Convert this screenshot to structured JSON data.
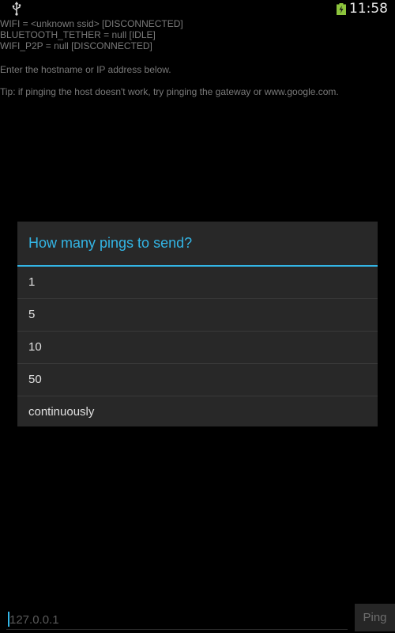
{
  "status_bar": {
    "usb_icon": "usb-icon",
    "battery_icon": "battery-charging-icon",
    "time": "11:58"
  },
  "network_status": [
    "WIFI = <unknown ssid> [DISCONNECTED]",
    "BLUETOOTH_TETHER = null [IDLE]",
    "WIFI_P2P = null [DISCONNECTED]"
  ],
  "instruction": "Enter the hostname or IP address below.",
  "tip": "Tip: if pinging the host doesn't work, try pinging the gateway or www.google.com.",
  "dialog": {
    "title": "How many pings to send?",
    "options": [
      "1",
      "5",
      "10",
      "50",
      "continuously"
    ]
  },
  "host_input": {
    "value": "127.0.0.1"
  },
  "ping_button": {
    "label": "Ping"
  },
  "colors": {
    "accent": "#33b5e5",
    "dialog_bg": "#282828",
    "background": "#000000"
  }
}
